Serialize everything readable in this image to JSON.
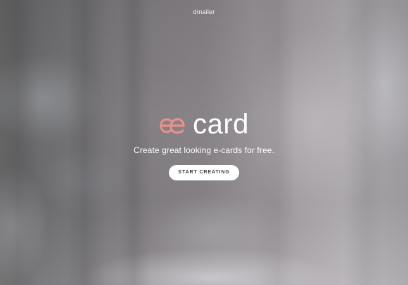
{
  "header": {
    "brand": "dmailer"
  },
  "hero": {
    "logo_icon": "ae-ligature-logo-icon",
    "logo_text": "card",
    "tagline": "Create great looking e-cards for free.",
    "cta_label": "START CREATING"
  },
  "colors": {
    "accent": "#e9908a",
    "cta_background": "#ffffff",
    "cta_text": "#3a3a3a"
  }
}
